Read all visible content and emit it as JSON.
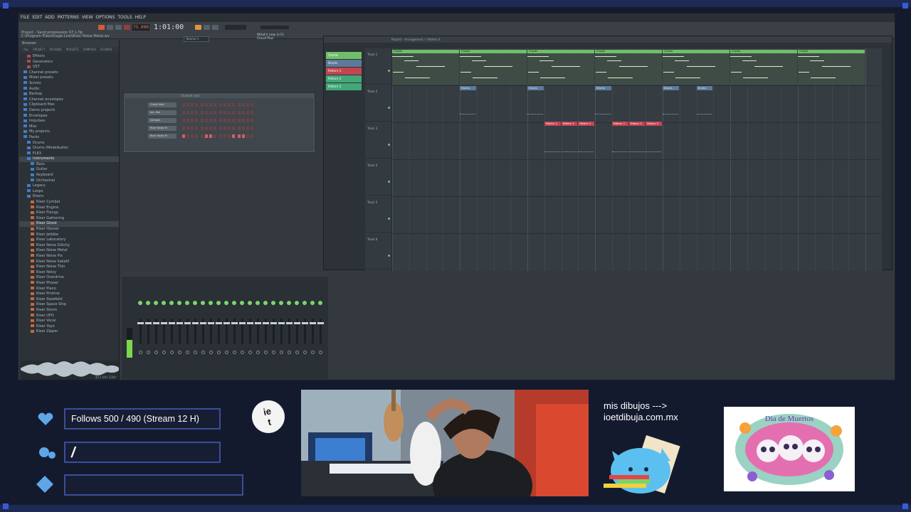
{
  "app": {
    "menu": [
      "FILE",
      "EDIT",
      "ADD",
      "PATTERNS",
      "VIEW",
      "OPTIONS",
      "TOOLS",
      "HELP"
    ],
    "song_title": "Project - Sand progression 67.1.flp",
    "song_path": "C:\\Program Files\\Image-Line\\Riser Noise Metal.wv",
    "tempo": "75.000",
    "time": "1:01:00",
    "hint_text": "Tutorial 1",
    "news_text": "What's new in FL Cloud Plus"
  },
  "browser": {
    "title": "Browser",
    "tabs": [
      "ALL",
      "PROJECT",
      "PLUGINS",
      "PRESETS",
      "SAMPLES",
      "SCORES"
    ],
    "items": [
      {
        "label": "Effects",
        "depth": 1,
        "icon": "folder-icon",
        "color": "#b04a4f"
      },
      {
        "label": "Generators",
        "depth": 1,
        "icon": "folder-icon",
        "color": "#b04a4f"
      },
      {
        "label": "VST",
        "depth": 1,
        "icon": "folder-icon",
        "color": "#b04a4f"
      },
      {
        "label": "Channel presets",
        "depth": 0,
        "icon": "folder-icon",
        "color": "#3f7ec9"
      },
      {
        "label": "Mixer presets",
        "depth": 0,
        "icon": "folder-icon",
        "color": "#3f7ec9"
      },
      {
        "label": "Scores",
        "depth": 0,
        "icon": "folder-icon",
        "color": "#3f7ec9"
      },
      {
        "label": "Audio",
        "depth": 0,
        "icon": "folder-icon",
        "color": "#3f7ec9"
      },
      {
        "label": "Backup",
        "depth": 0,
        "icon": "folder-icon",
        "color": "#3f7ec9"
      },
      {
        "label": "Channel envelopes",
        "depth": 0,
        "icon": "folder-icon",
        "color": "#3f7ec9"
      },
      {
        "label": "Clipboard files",
        "depth": 0,
        "icon": "folder-icon",
        "color": "#3f7ec9"
      },
      {
        "label": "Demo projects",
        "depth": 0,
        "icon": "folder-icon",
        "color": "#3f7ec9"
      },
      {
        "label": "Envelopes",
        "depth": 0,
        "icon": "folder-icon",
        "color": "#3f7ec9"
      },
      {
        "label": "Impulses",
        "depth": 0,
        "icon": "folder-icon",
        "color": "#3f7ec9"
      },
      {
        "label": "Misc",
        "depth": 0,
        "icon": "folder-icon",
        "color": "#3f7ec9"
      },
      {
        "label": "My projects",
        "depth": 0,
        "icon": "folder-icon",
        "color": "#3f7ec9"
      },
      {
        "label": "Packs",
        "depth": 0,
        "icon": "folder-icon",
        "color": "#3f7ec9"
      },
      {
        "label": "Drums",
        "depth": 1,
        "icon": "folder-icon",
        "color": "#3f7ec9"
      },
      {
        "label": "Drums (ModeAudio)",
        "depth": 1,
        "icon": "folder-icon",
        "color": "#3f7ec9"
      },
      {
        "label": "FLEX",
        "depth": 1,
        "icon": "folder-icon",
        "color": "#3f7ec9"
      },
      {
        "label": "Instruments",
        "depth": 1,
        "icon": "folder-icon",
        "color": "#3f7ec9",
        "selected": true
      },
      {
        "label": "Bass",
        "depth": 2,
        "icon": "folder-icon",
        "color": "#3f7ec9"
      },
      {
        "label": "Guitar",
        "depth": 2,
        "icon": "folder-icon",
        "color": "#3f7ec9"
      },
      {
        "label": "Keyboard",
        "depth": 2,
        "icon": "folder-icon",
        "color": "#3f7ec9"
      },
      {
        "label": "Orchestral",
        "depth": 2,
        "icon": "folder-icon",
        "color": "#3f7ec9"
      },
      {
        "label": "Legacy",
        "depth": 1,
        "icon": "folder-icon",
        "color": "#3f7ec9"
      },
      {
        "label": "Loops",
        "depth": 1,
        "icon": "folder-icon",
        "color": "#3f7ec9"
      },
      {
        "label": "Risers",
        "depth": 1,
        "icon": "folder-icon",
        "color": "#3f7ec9"
      },
      {
        "label": "Riser Cymbal",
        "depth": 2,
        "icon": "audio-file-icon",
        "color": "#c46a3a"
      },
      {
        "label": "Riser Engine",
        "depth": 2,
        "icon": "audio-file-icon",
        "color": "#c46a3a"
      },
      {
        "label": "Riser Flangy",
        "depth": 2,
        "icon": "audio-file-icon",
        "color": "#c46a3a"
      },
      {
        "label": "Riser Gathering",
        "depth": 2,
        "icon": "audio-file-icon",
        "color": "#c46a3a"
      },
      {
        "label": "Riser Ghost",
        "depth": 2,
        "icon": "audio-file-icon",
        "color": "#c46a3a",
        "selected": true
      },
      {
        "label": "Riser Hoover",
        "depth": 2,
        "icon": "audio-file-icon",
        "color": "#c46a3a"
      },
      {
        "label": "Riser Jetbike",
        "depth": 2,
        "icon": "audio-file-icon",
        "color": "#c46a3a"
      },
      {
        "label": "Riser Laboratory",
        "depth": 2,
        "icon": "audio-file-icon",
        "color": "#c46a3a"
      },
      {
        "label": "Riser Noise Glitchy",
        "depth": 2,
        "icon": "audio-file-icon",
        "color": "#c46a3a"
      },
      {
        "label": "Riser Noise Metal",
        "depth": 2,
        "icon": "audio-file-icon",
        "color": "#c46a3a"
      },
      {
        "label": "Riser Noise Pix",
        "depth": 2,
        "icon": "audio-file-icon",
        "color": "#c46a3a"
      },
      {
        "label": "Riser Noise Sakelif",
        "depth": 2,
        "icon": "audio-file-icon",
        "color": "#c46a3a"
      },
      {
        "label": "Riser Noise Thin",
        "depth": 2,
        "icon": "audio-file-icon",
        "color": "#c46a3a"
      },
      {
        "label": "Riser Noisy",
        "depth": 2,
        "icon": "audio-file-icon",
        "color": "#c46a3a"
      },
      {
        "label": "Riser Overdrive",
        "depth": 2,
        "icon": "audio-file-icon",
        "color": "#c46a3a"
      },
      {
        "label": "Riser Phaser",
        "depth": 2,
        "icon": "audio-file-icon",
        "color": "#c46a3a"
      },
      {
        "label": "Riser Piano",
        "depth": 2,
        "icon": "audio-file-icon",
        "color": "#c46a3a"
      },
      {
        "label": "Riser Pristine",
        "depth": 2,
        "icon": "audio-file-icon",
        "color": "#c46a3a"
      },
      {
        "label": "Riser Siewfield",
        "depth": 2,
        "icon": "audio-file-icon",
        "color": "#c46a3a"
      },
      {
        "label": "Riser Space Ship",
        "depth": 2,
        "icon": "audio-file-icon",
        "color": "#c46a3a"
      },
      {
        "label": "Riser Storm",
        "depth": 2,
        "icon": "audio-file-icon",
        "color": "#c46a3a"
      },
      {
        "label": "Riser UFO",
        "depth": 2,
        "icon": "audio-file-icon",
        "color": "#c46a3a"
      },
      {
        "label": "Riser Vocal",
        "depth": 2,
        "icon": "audio-file-icon",
        "color": "#c46a3a"
      },
      {
        "label": "Riser Yoyo",
        "depth": 2,
        "icon": "audio-file-icon",
        "color": "#c46a3a"
      },
      {
        "label": "Riser Zipper",
        "depth": 2,
        "icon": "audio-file-icon",
        "color": "#c46a3a"
      }
    ],
    "wave_info": "44.1 kHz 32bit"
  },
  "channel_rack": {
    "title": "Channel rack",
    "channels": [
      {
        "name": "Chord Hold",
        "steps": [
          0,
          0,
          0,
          0,
          0,
          0,
          0,
          0,
          0,
          0,
          0,
          0,
          0,
          0,
          0,
          0
        ]
      },
      {
        "name": "Ind. Hat",
        "steps": [
          0,
          0,
          0,
          0,
          0,
          0,
          0,
          0,
          0,
          0,
          0,
          0,
          0,
          0,
          0,
          0
        ]
      },
      {
        "name": "Sampler",
        "steps": [
          0,
          0,
          0,
          0,
          0,
          0,
          0,
          0,
          0,
          0,
          0,
          0,
          0,
          0,
          0,
          0
        ]
      },
      {
        "name": "Riser Noise M",
        "steps": [
          0,
          0,
          0,
          0,
          0,
          0,
          0,
          0,
          0,
          0,
          0,
          0,
          0,
          0,
          0,
          0
        ]
      },
      {
        "name": "Riser Noise M",
        "steps": [
          1,
          0,
          0,
          0,
          0,
          1,
          1,
          0,
          0,
          0,
          0,
          1,
          1,
          1,
          0,
          0
        ]
      }
    ]
  },
  "playlist": {
    "title": "Playlist - Arrangement > Pattern 4",
    "patterns": [
      {
        "name": "Chords",
        "color": "#6fbf69"
      },
      {
        "name": "Drums",
        "color": "#5d7a9a"
      },
      {
        "name": "Pattern 3",
        "color": "#c24550"
      },
      {
        "name": "Pattern 4",
        "color": "#43a77a"
      },
      {
        "name": "Pattern 5",
        "color": "#43a77a"
      }
    ],
    "tracks": [
      "Track 1",
      "Track 2",
      "Track 3",
      "Track 4",
      "Track 5",
      "Track 6"
    ],
    "chord_clips": [
      {
        "label": "Chords",
        "start": 0.0,
        "len": 1.0
      },
      {
        "label": "Chords",
        "start": 1.0,
        "len": 1.0
      },
      {
        "label": "Chords",
        "start": 2.0,
        "len": 1.0
      },
      {
        "label": "Chords",
        "start": 3.0,
        "len": 1.0
      },
      {
        "label": "Chords",
        "start": 4.0,
        "len": 1.0
      },
      {
        "label": "Chords",
        "start": 5.0,
        "len": 1.0
      },
      {
        "label": "Chords",
        "start": 6.0,
        "len": 1.0
      }
    ],
    "drum_clips": [
      {
        "label": "Drums",
        "start": 1.0,
        "len": 0.25
      },
      {
        "label": "Drums",
        "start": 2.0,
        "len": 0.25
      },
      {
        "label": "Drums",
        "start": 3.0,
        "len": 0.25
      },
      {
        "label": "Drums",
        "start": 4.0,
        "len": 0.25
      },
      {
        "label": "Drums",
        "start": 4.5,
        "len": 0.25
      }
    ],
    "riser_clips": [
      {
        "label": "Pattern 3",
        "start": 2.25,
        "len": 0.25
      },
      {
        "label": "Pattern 3",
        "start": 2.5,
        "len": 0.25
      },
      {
        "label": "Pattern 3",
        "start": 2.75,
        "len": 0.25
      },
      {
        "label": "Pattern 3",
        "start": 3.25,
        "len": 0.25
      },
      {
        "label": "Pattern 3",
        "start": 3.5,
        "len": 0.25
      },
      {
        "label": "Pattern 3",
        "start": 3.75,
        "len": 0.25
      }
    ],
    "bars": 7
  },
  "mixer": {
    "strip_count": 24,
    "master_level": 0.6
  },
  "overlay": {
    "follows_goal": "Follows 500 / 490 (Stream 12 H)",
    "chat_prompt": "/",
    "logo_text": "ie\nt",
    "promo_line1": "mis dibujos --->",
    "promo_line2": "ioetdibuja.com.mx",
    "art_card_text": "Dia de Muertos",
    "accent": "#3a4f98"
  }
}
